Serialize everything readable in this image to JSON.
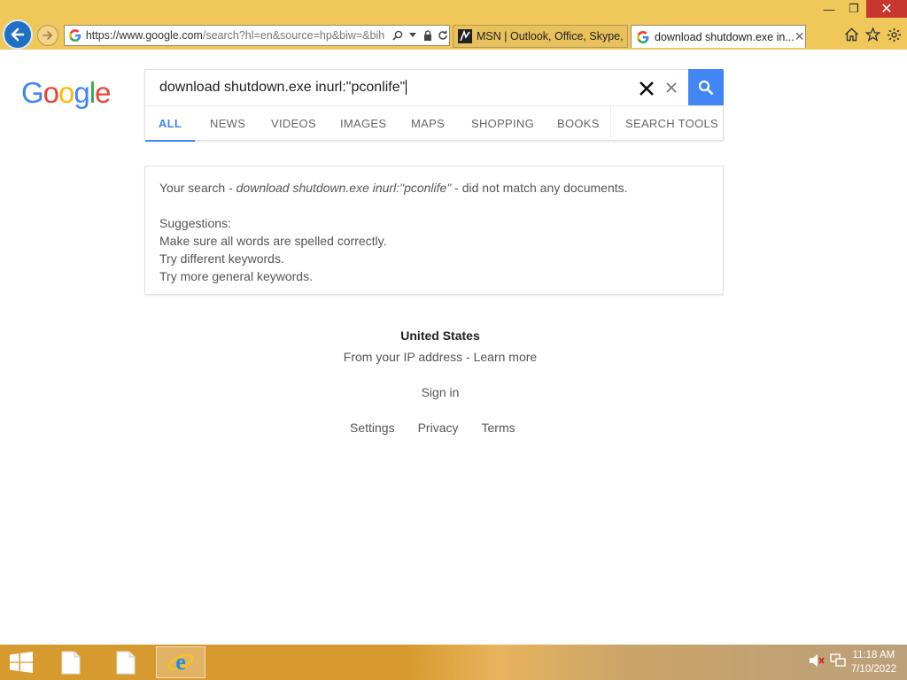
{
  "browser": {
    "url_bold": "https://www.google.com",
    "url_rest": "/search?hl=en&source=hp&biw=&bih",
    "tabs": [
      {
        "title": "MSN | Outlook, Office, Skype, ...",
        "active": false
      },
      {
        "title": "download shutdown.exe in...",
        "active": true
      }
    ],
    "window_controls": [
      "minimize",
      "restore",
      "close"
    ]
  },
  "logo": {
    "letters": [
      {
        "ch": "G",
        "color": "#4285f4"
      },
      {
        "ch": "o",
        "color": "#ea4335"
      },
      {
        "ch": "o",
        "color": "#fbbc05"
      },
      {
        "ch": "g",
        "color": "#4285f4"
      },
      {
        "ch": "l",
        "color": "#34a853"
      },
      {
        "ch": "e",
        "color": "#ea4335"
      }
    ]
  },
  "search": {
    "query": "download shutdown.exe inurl:\"pconlife\"",
    "tabs": [
      "ALL",
      "NEWS",
      "VIDEOS",
      "IMAGES",
      "MAPS",
      "SHOPPING",
      "BOOKS"
    ],
    "active_tab": "ALL",
    "tools_label": "SEARCH TOOLS"
  },
  "result": {
    "prefix": "Your search - ",
    "term": "download shutdown.exe inurl:\"pconlife\"",
    "suffix": " - did not match any documents.",
    "suggestions_title": "Suggestions:",
    "suggestions": [
      "Make sure all words are spelled correctly.",
      "Try different keywords.",
      "Try more general keywords."
    ]
  },
  "footer": {
    "country": "United States",
    "ip_text": "From your IP address",
    "separator": " - ",
    "learn_more": "Learn more",
    "sign_in": "Sign in",
    "links": [
      "Settings",
      "Privacy",
      "Terms"
    ]
  },
  "taskbar": {
    "time": "11:18 AM",
    "date": "7/10/2022"
  },
  "colors": {
    "accent": "#4285f4",
    "chrome": "#f0c85a",
    "close_button": "#c7372f"
  }
}
